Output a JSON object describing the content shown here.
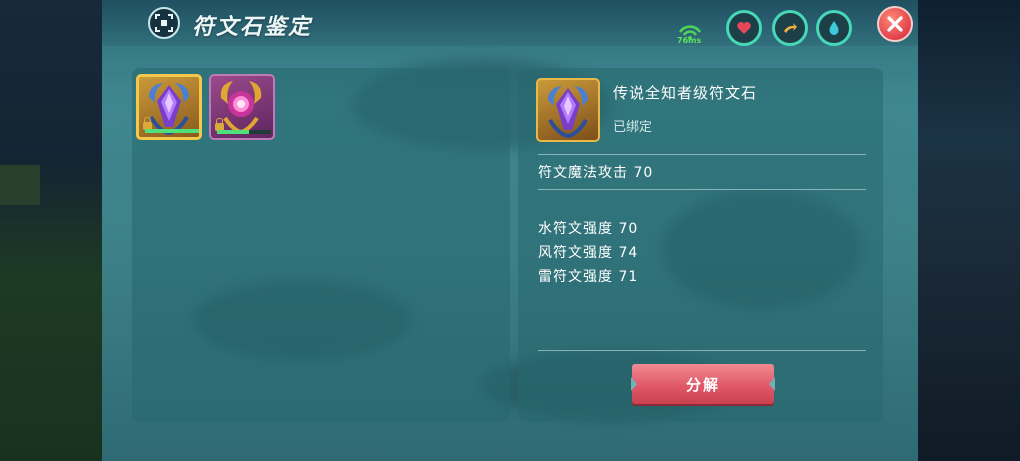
{
  "window": {
    "title": "符文石鉴定",
    "network_label": "76ms"
  },
  "status_gauges": [
    {
      "icon": "heart-icon",
      "color": "#e8475a"
    },
    {
      "icon": "stamina-icon",
      "color": "#f0b23a"
    },
    {
      "icon": "water-drop-icon",
      "color": "#3fc8d8"
    }
  ],
  "inventory": {
    "items": [
      {
        "name": "传说全知者级符文石",
        "icon": "rune-stone-purple-icon",
        "locked": true,
        "progress": 1.0,
        "selected": true
      },
      {
        "name": "rune-stone-gold",
        "icon": "rune-stone-gold-icon",
        "locked": true,
        "progress": 0.6,
        "selected": false
      }
    ]
  },
  "detail": {
    "item_name": "传说全知者级符文石",
    "bind_status": "已绑定",
    "main_stat": "符文魔法攻击 70",
    "sub_stats": [
      "水符文强度 70",
      "风符文强度 74",
      "雷符文强度 71"
    ],
    "decompose_label": "分解"
  },
  "colors": {
    "accent_green": "#4fe07a",
    "button_red": "#e0596a",
    "selected_border": "#f3c84b"
  }
}
